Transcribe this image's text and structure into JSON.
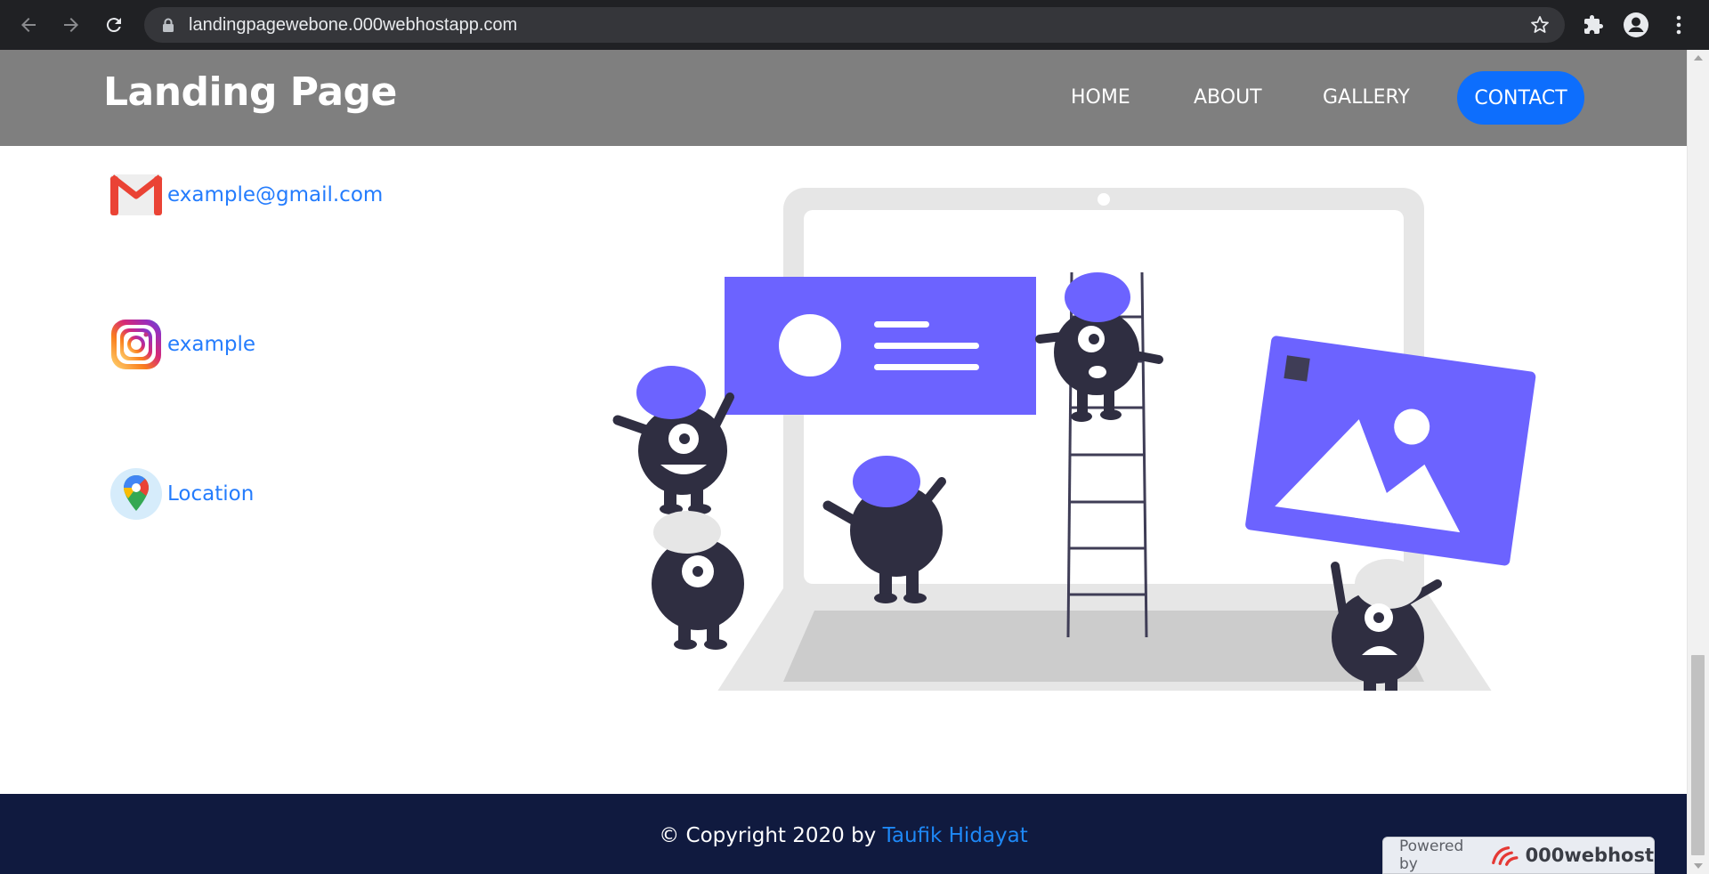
{
  "browser": {
    "url": "landingpagewebone.000webhostapp.com"
  },
  "header": {
    "brand": "Landing Page",
    "nav": [
      {
        "label": "HOME"
      },
      {
        "label": "ABOUT"
      },
      {
        "label": "GALLERY"
      },
      {
        "label": "CONTACT"
      }
    ]
  },
  "contacts": [
    {
      "icon": "gmail-icon",
      "label": "example@gmail.com"
    },
    {
      "icon": "instagram-icon",
      "label": "example"
    },
    {
      "icon": "google-maps-icon",
      "label": "Location"
    }
  ],
  "footer": {
    "copyright": "© Copyright 2020 by ",
    "author": "Taufik Hidayat",
    "powered_by": "Powered by",
    "host": "000webhost"
  },
  "colors": {
    "header_bg": "#7f7f7f",
    "accent": "#0d6efd",
    "footer_bg": "#101a3f",
    "illustration_purple": "#6c63ff",
    "illustration_dark": "#2f2e41"
  }
}
